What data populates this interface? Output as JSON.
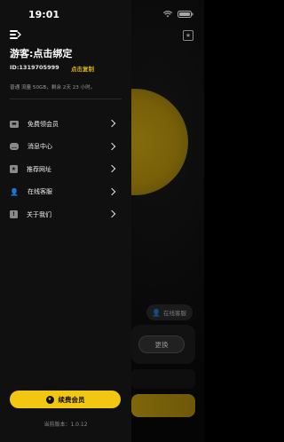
{
  "status_bar": {
    "time": "19:01"
  },
  "drawer": {
    "guest_title": "游客:点击绑定",
    "user_id": "ID:1319705999",
    "copy_label": "点击复制",
    "plan_info": "普通 流量 50GB，剩余 2天 23 小时。",
    "menu": [
      {
        "label": "免费领会员",
        "icon": "gift-card-icon"
      },
      {
        "label": "消息中心",
        "icon": "chat-icon"
      },
      {
        "label": "推荐网址",
        "icon": "star-icon"
      },
      {
        "label": "在线客服",
        "icon": "support-agent-icon"
      },
      {
        "label": "关于我们",
        "icon": "info-icon"
      }
    ],
    "renew_label": "续费会员",
    "version": "当前版本：1.0.12"
  },
  "background": {
    "support_chip": "在线客服",
    "change_button": "更换"
  },
  "colors": {
    "accent": "#f2c712",
    "drawer_bg": "#101010"
  }
}
